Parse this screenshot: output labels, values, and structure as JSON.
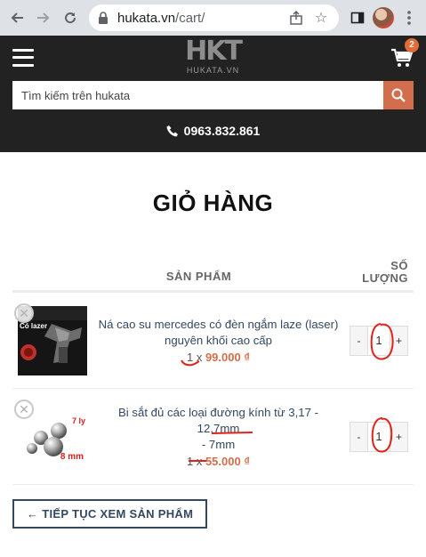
{
  "browser": {
    "url_host": "hukata.vn",
    "url_path": "/cart/"
  },
  "header": {
    "logo_mark": "HKT",
    "logo_sub": "HUKATA.VN",
    "cart_count": "2",
    "search_placeholder": "Tìm kiếm trên hukata",
    "phone": "0963.832.861"
  },
  "page": {
    "title": "GIỎ HÀNG"
  },
  "table": {
    "col_product": "SẢN PHẨM",
    "col_qty_line1": "SỐ",
    "col_qty_line2": "LƯỢNG"
  },
  "items": [
    {
      "name": "Ná cao su mercedes có đèn ngắm laze (laser) nguyên khối cao cấp",
      "qty_prefix": "1",
      "price": "99.000 ₫",
      "quantity": "1",
      "thumb_text": "Có lazer"
    },
    {
      "name": "Bi sắt đủ các loại đường kính từ 3,17 - 12,7mm",
      "name_line2": "- 7mm",
      "qty_prefix": "1",
      "price": "55.000 ₫",
      "quantity": "1",
      "thumb_label_a": "7 ly",
      "thumb_label_b": "8 mm"
    }
  ],
  "actions": {
    "continue_label": "← TIẾP TỤC XEM SẢN PHẨM"
  },
  "colors": {
    "accent": "#d26e4b",
    "header_bg": "#222222",
    "link": "#334862",
    "annotation": "#e0241b"
  }
}
